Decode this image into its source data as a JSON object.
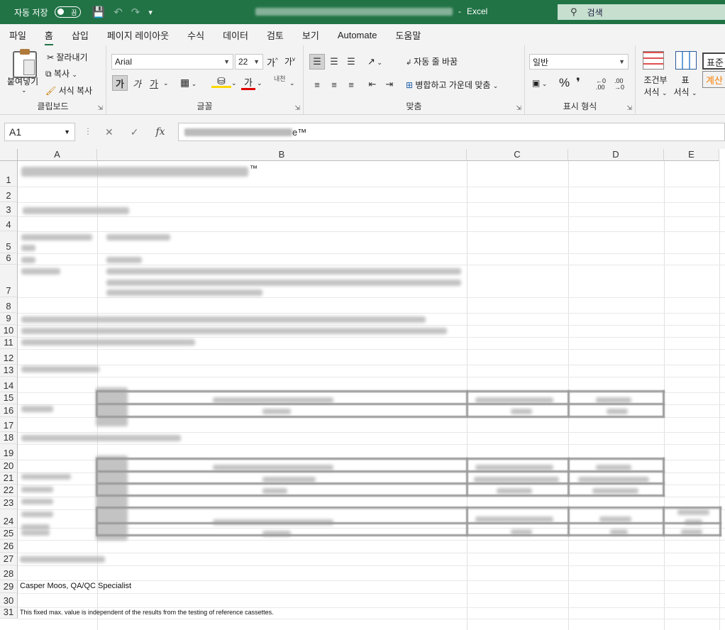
{
  "titlebar": {
    "autosave_label": "자동 저장",
    "autosave_state": "끔",
    "app_name": "Excel",
    "search_placeholder": "검색"
  },
  "tabs": [
    "파일",
    "홈",
    "삽입",
    "페이지 레이아웃",
    "수식",
    "데이터",
    "검토",
    "보기",
    "Automate",
    "도움말"
  ],
  "active_tab": "홈",
  "ribbon": {
    "clipboard": {
      "paste": "붙여넣기",
      "cut": "잘라내기",
      "copy": "복사",
      "format_painter": "서식 복사",
      "label": "클립보드"
    },
    "font": {
      "name": "Arial",
      "size": "22",
      "bold": "가",
      "italic": "가",
      "underline": "가",
      "font_color_glyph": "가",
      "phonetic": "내천",
      "label": "글꼴"
    },
    "alignment": {
      "wrap": "자동 줄 바꿈",
      "merge": "병합하고 가운데 맞춤",
      "label": "맞춤"
    },
    "number": {
      "format": "일반",
      "percent": "%",
      "comma": "❜",
      "label": "표시 형식"
    },
    "styles": {
      "conditional": "조건부",
      "conditional2": "서식",
      "table": "표",
      "table2": "서식",
      "style_normal": "표준",
      "style_calc": "계산"
    }
  },
  "formulabar": {
    "namebox": "A1",
    "fx": "fx",
    "content_visible": "e™"
  },
  "columns": [
    "A",
    "B",
    "C",
    "D",
    "E"
  ],
  "rows": [
    "1",
    "2",
    "3",
    "4",
    "5",
    "6",
    "7",
    "8",
    "9",
    "10",
    "11",
    "12",
    "13",
    "14",
    "15",
    "16",
    "17",
    "18",
    "19",
    "20",
    "21",
    "22",
    "23",
    "24",
    "25",
    "26",
    "27",
    "28",
    "29",
    "30",
    "31"
  ],
  "cells": {
    "a1_suffix": "™",
    "a29": "Casper Moos, QA/QC Specialist",
    "a31": "This fixed max. value is independent of the results from the testing of reference cassettes."
  }
}
